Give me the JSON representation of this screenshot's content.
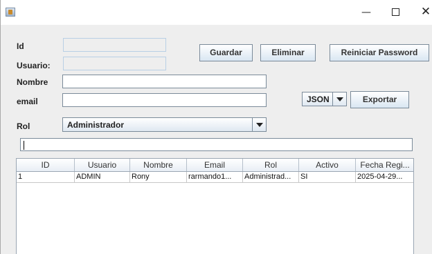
{
  "window": {
    "minimize_glyph": "—",
    "close_glyph": "✕"
  },
  "form": {
    "id_label": "Id",
    "usuario_label": "Usuario:",
    "nombre_label": "Nombre",
    "email_label": "email",
    "rol_label": "Rol",
    "id_value": "",
    "usuario_value": "",
    "nombre_value": "",
    "email_value": "",
    "rol_selected": "Administrador",
    "format_selected": "JSON",
    "search_value": ""
  },
  "buttons": {
    "guardar": "Guardar",
    "eliminar": "Eliminar",
    "reiniciar": "Reiniciar Password",
    "exportar": "Exportar"
  },
  "table": {
    "columns": [
      "ID",
      "Usuario",
      "Nombre",
      "Email",
      "Rol",
      "Activo",
      "Fecha Regi..."
    ],
    "rows": [
      [
        "1",
        "ADMIN",
        "Rony",
        "rarmando1...",
        "Administrad...",
        "SI",
        "2025-04-29..."
      ]
    ]
  },
  "colors": {
    "window_bg": "#eeeeee",
    "button_gradient_end": "#d9e6f2",
    "border": "#7a8a99"
  }
}
